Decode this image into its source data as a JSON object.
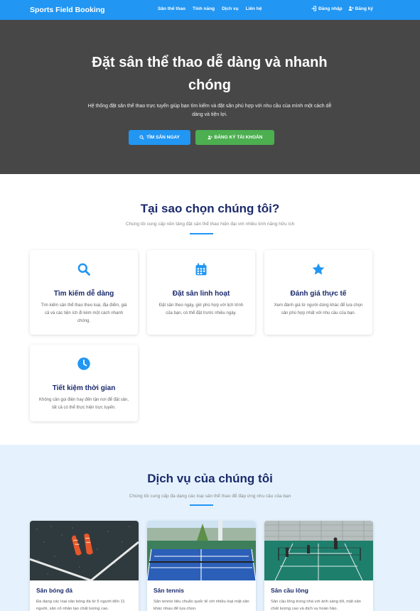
{
  "navbar": {
    "brand": "Sports Field Booking",
    "links": [
      "Sân thể thao",
      "Tính năng",
      "Dịch vụ",
      "Liên hệ"
    ],
    "login": "Đăng nhập",
    "register": "Đăng ký",
    "color": "#2196f3"
  },
  "hero": {
    "title": "Đặt sân thể thao dễ dàng và nhanh chóng",
    "subtitle": "Hệ thống đặt sân thể thao trực tuyến giúp bạn tìm kiếm và đặt sân phù hợp với nhu cầu của mình một cách dễ dàng và tiện lợi.",
    "search_button": "TÌM SÂN NGAY",
    "register_button": "ĐĂNG KÝ TÀI KHOẢN"
  },
  "why": {
    "title": "Tại sao chọn chúng tôi?",
    "subtitle": "Chúng tôi cung cấp nền tảng đặt sân thể thao hiện đại với nhiều tính năng hữu ích",
    "features": [
      {
        "icon": "search-icon",
        "title": "Tìm kiếm dễ dàng",
        "desc": "Tìm kiếm sân thể thao theo loại, địa điểm, giá cả và các tiện ích đi kèm một cách nhanh chóng."
      },
      {
        "icon": "calendar-icon",
        "title": "Đặt sân linh hoạt",
        "desc": "Đặt sân theo ngày, giờ phù hợp với lịch trình của bạn, có thể đặt trước nhiều ngày."
      },
      {
        "icon": "star-icon",
        "title": "Đánh giá thực tế",
        "desc": "Xem đánh giá từ người dùng khác để lựa chọn sân phù hợp nhất với nhu cầu của bạn."
      },
      {
        "icon": "clock-icon",
        "title": "Tiết kiệm thời gian",
        "desc": "Không cần gọi điện hay đến tận nơi để đặt sân, tất cả có thể thực hiện trực tuyến."
      }
    ]
  },
  "services": {
    "title": "Dịch vụ của chúng tôi",
    "subtitle": "Chúng tôi cung cấp đa dạng các loại sân thể thao để đáp ứng nhu cầu của bạn",
    "items": [
      {
        "title": "Sân bóng đá",
        "desc": "Đa dạng các loại sân bóng đá từ 5 người đến 11 người, sân cỏ nhân tạo chất lượng cao."
      },
      {
        "title": "Sân tennis",
        "desc": "Sân tennis tiêu chuẩn quốc tế với nhiều loại mặt sân khác nhau để lựa chọn."
      },
      {
        "title": "Sân cầu lông",
        "desc": "Sân cầu lông trong nhà với ánh sáng tốt, mặt sân chất lượng cao và dịch vụ hoàn hảo."
      }
    ]
  }
}
